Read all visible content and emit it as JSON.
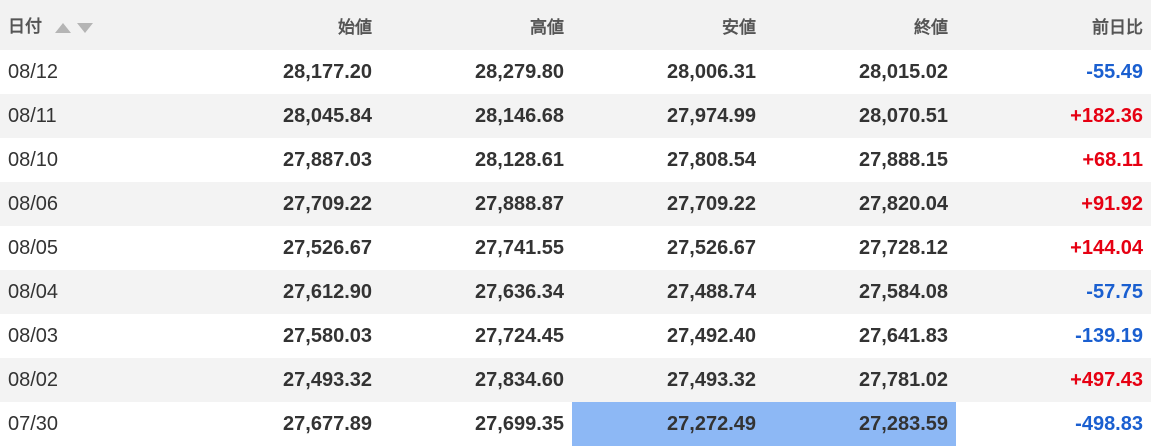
{
  "table": {
    "headers": {
      "date": "日付",
      "open": "始値",
      "high": "高値",
      "low": "安値",
      "close": "終値",
      "change": "前日比"
    },
    "sort_icons": [
      "sort-ascending-icon",
      "sort-descending-icon"
    ],
    "colors": {
      "positive": "#e60012",
      "negative": "#1a5fd0",
      "selection": "#8db8f5"
    },
    "rows": [
      {
        "date": "08/12",
        "open": "28,177.20",
        "high": "28,279.80",
        "low": "28,006.31",
        "close": "28,015.02",
        "change": "-55.49"
      },
      {
        "date": "08/11",
        "open": "28,045.84",
        "high": "28,146.68",
        "low": "27,974.99",
        "close": "28,070.51",
        "change": "+182.36"
      },
      {
        "date": "08/10",
        "open": "27,887.03",
        "high": "28,128.61",
        "low": "27,808.54",
        "close": "27,888.15",
        "change": "+68.11"
      },
      {
        "date": "08/06",
        "open": "27,709.22",
        "high": "27,888.87",
        "low": "27,709.22",
        "close": "27,820.04",
        "change": "+91.92"
      },
      {
        "date": "08/05",
        "open": "27,526.67",
        "high": "27,741.55",
        "low": "27,526.67",
        "close": "27,728.12",
        "change": "+144.04"
      },
      {
        "date": "08/04",
        "open": "27,612.90",
        "high": "27,636.34",
        "low": "27,488.74",
        "close": "27,584.08",
        "change": "-57.75"
      },
      {
        "date": "08/03",
        "open": "27,580.03",
        "high": "27,724.45",
        "low": "27,492.40",
        "close": "27,641.83",
        "change": "-139.19"
      },
      {
        "date": "08/02",
        "open": "27,493.32",
        "high": "27,834.60",
        "low": "27,493.32",
        "close": "27,781.02",
        "change": "+497.43"
      },
      {
        "date": "07/30",
        "open": "27,677.89",
        "high": "27,699.35",
        "low": "27,272.49",
        "close": "27,283.59",
        "change": "-498.83"
      }
    ]
  }
}
